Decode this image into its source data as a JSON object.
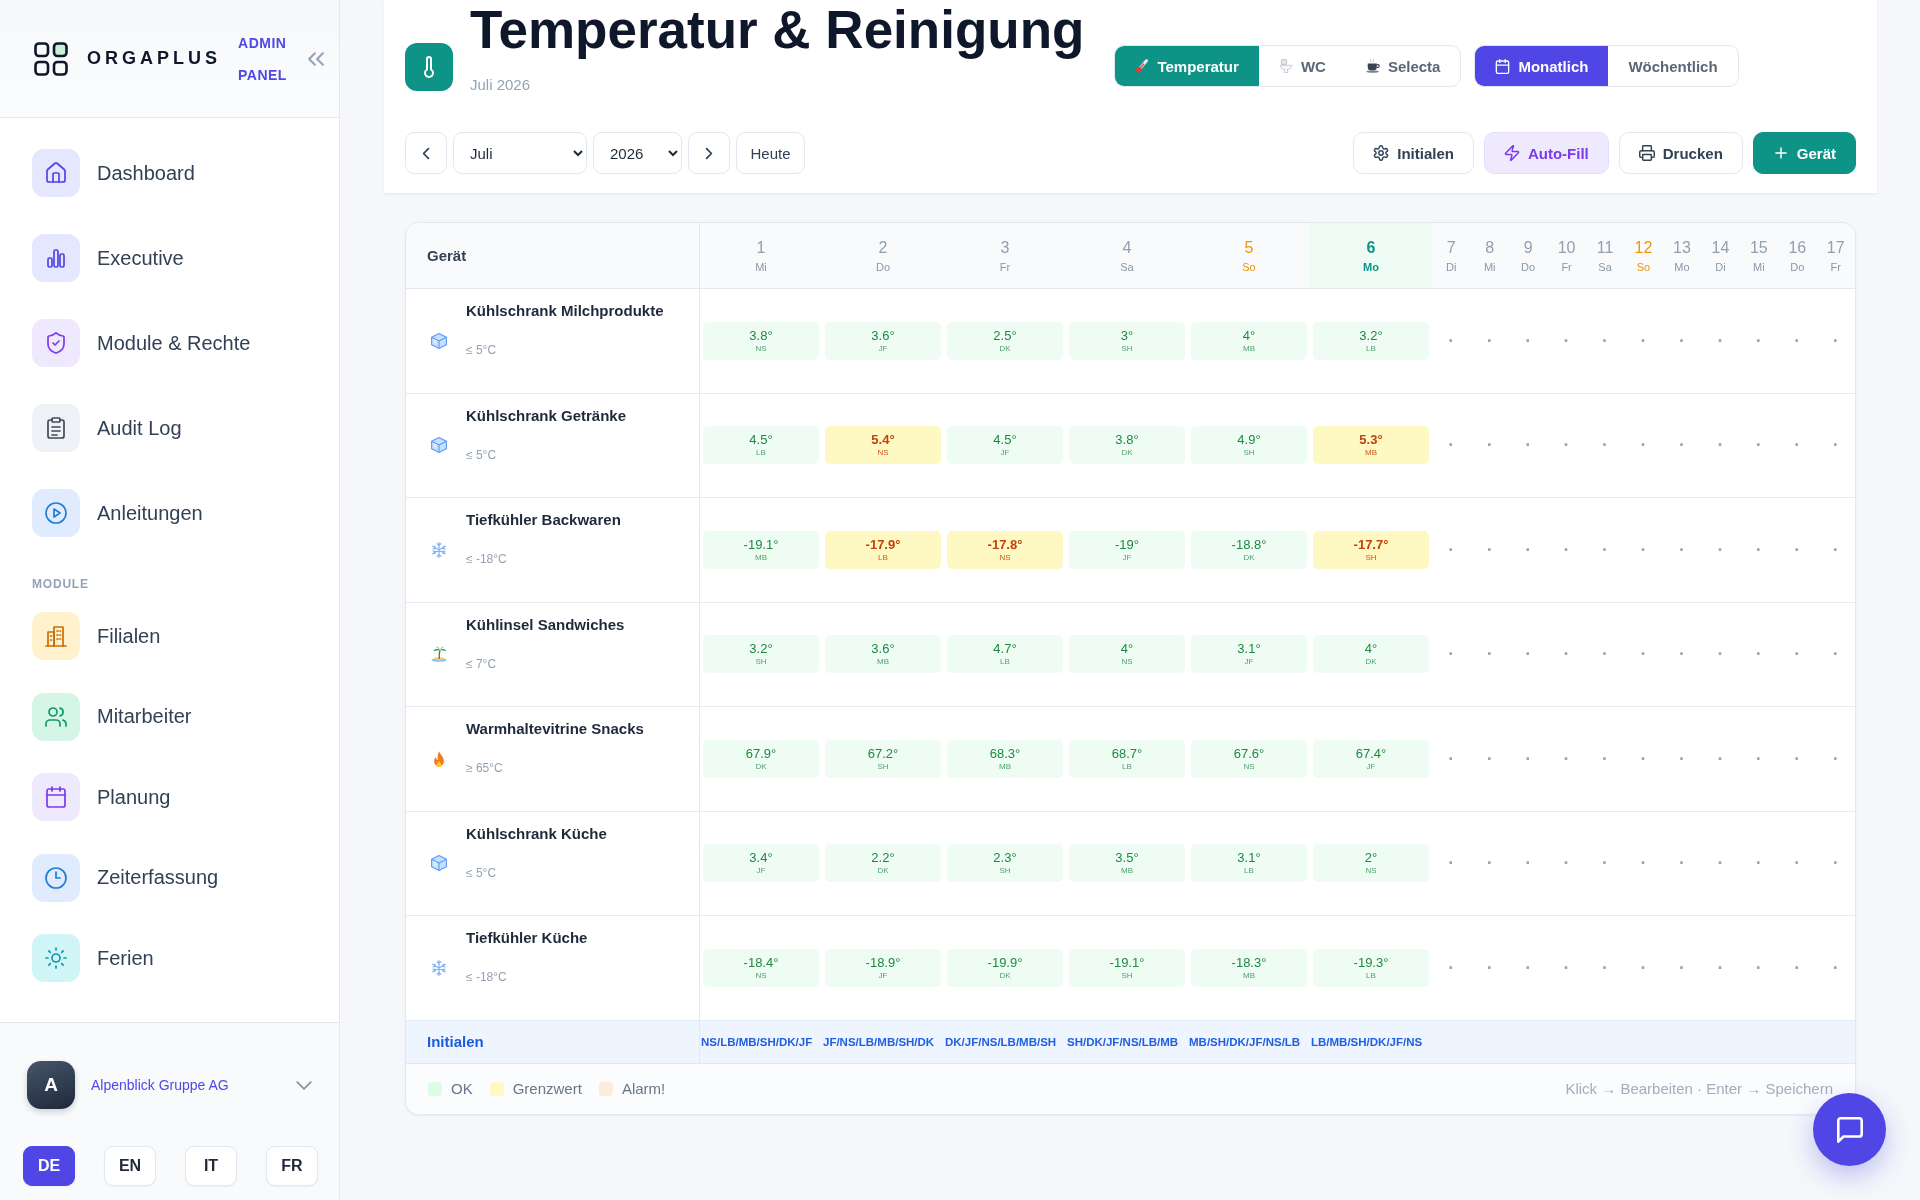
{
  "sidebar": {
    "brand": {
      "name": "ORGAPLUS",
      "tagline": "ADMIN PANEL"
    },
    "nav": [
      {
        "label": "Dashboard",
        "selected": false
      },
      {
        "label": "Executive",
        "selected": false
      },
      {
        "label": "Module & Rechte",
        "selected": false
      },
      {
        "label": "Audit Log",
        "selected": false
      },
      {
        "label": "Anleitungen",
        "selected": false
      }
    ],
    "sections": [
      {
        "title": "MODULE",
        "items": [
          {
            "label": "Filialen",
            "selected": false
          },
          {
            "label": "Mitarbeiter",
            "selected": false
          },
          {
            "label": "Planung",
            "selected": false
          },
          {
            "label": "Zeiterfassung",
            "selected": false
          },
          {
            "label": "Ferien",
            "selected": false
          }
        ]
      }
    ],
    "account": {
      "initial": "A",
      "name": "Alpenblick Gruppe AG"
    },
    "languages": [
      {
        "label": "DE",
        "selected": true
      },
      {
        "label": "EN",
        "selected": false
      },
      {
        "label": "IT",
        "selected": false
      },
      {
        "label": "FR",
        "selected": false
      }
    ]
  },
  "header": {
    "title": "Temperatur & Reinigung",
    "subtitle": "Juli 2026",
    "tabs": [
      {
        "label": "Temperatur",
        "selected": true
      },
      {
        "label": "WC",
        "selected": false
      },
      {
        "label": "Selecta",
        "selected": false
      }
    ],
    "views": [
      {
        "label": "Monatlich",
        "selected": true
      },
      {
        "label": "Wöchentlich",
        "selected": false
      }
    ],
    "month": "Juli",
    "year": "2026",
    "today_button": "Heute",
    "actions": [
      {
        "label": "Initialen",
        "kind": "plain"
      },
      {
        "label": "Auto-Fill",
        "kind": "soft"
      },
      {
        "label": "Drucken",
        "kind": "plain"
      },
      {
        "label": "Gerät",
        "kind": "primary"
      }
    ]
  },
  "table": {
    "device_heading": "Gerät",
    "days": [
      {
        "number": "1",
        "weekday": "Mi",
        "today": false,
        "sunday": false
      },
      {
        "number": "2",
        "weekday": "Do",
        "today": false,
        "sunday": false
      },
      {
        "number": "3",
        "weekday": "Fr",
        "today": false,
        "sunday": false
      },
      {
        "number": "4",
        "weekday": "Sa",
        "today": false,
        "sunday": false
      },
      {
        "number": "5",
        "weekday": "So",
        "today": false,
        "sunday": true
      },
      {
        "number": "6",
        "weekday": "Mo",
        "today": true,
        "sunday": false
      },
      {
        "number": "7",
        "weekday": "Di",
        "today": false,
        "sunday": false
      },
      {
        "number": "8",
        "weekday": "Mi",
        "today": false,
        "sunday": false
      },
      {
        "number": "9",
        "weekday": "Do",
        "today": false,
        "sunday": false
      },
      {
        "number": "10",
        "weekday": "Fr",
        "today": false,
        "sunday": false
      },
      {
        "number": "11",
        "weekday": "Sa",
        "today": false,
        "sunday": false
      },
      {
        "number": "12",
        "weekday": "So",
        "today": false,
        "sunday": true
      },
      {
        "number": "13",
        "weekday": "Mo",
        "today": false,
        "sunday": false
      },
      {
        "number": "14",
        "weekday": "Di",
        "today": false,
        "sunday": false
      },
      {
        "number": "15",
        "weekday": "Mi",
        "today": false,
        "sunday": false
      },
      {
        "number": "16",
        "weekday": "Do",
        "today": false,
        "sunday": false
      },
      {
        "number": "17",
        "weekday": "Fr",
        "today": false,
        "sunday": false
      }
    ],
    "rows": [
      {
        "kind": "fridge",
        "name": "Kühlschrank Milchprodukte",
        "limit": "≤ 5°C",
        "readings": [
          {
            "kind": "reading",
            "value": "3.8°",
            "initials": "NS",
            "warning": false
          },
          {
            "kind": "reading",
            "value": "3.6°",
            "initials": "JF",
            "warning": false
          },
          {
            "kind": "reading",
            "value": "2.5°",
            "initials": "DK",
            "warning": false
          },
          {
            "kind": "reading",
            "value": "3°",
            "initials": "SH",
            "warning": false
          },
          {
            "kind": "reading",
            "value": "4°",
            "initials": "MB",
            "warning": false
          },
          {
            "kind": "reading",
            "value": "3.2°",
            "initials": "LB",
            "warning": false
          },
          {
            "kind": "empty",
            "mark": "·"
          },
          {
            "kind": "empty",
            "mark": "·"
          },
          {
            "kind": "empty",
            "mark": "·"
          },
          {
            "kind": "empty",
            "mark": "·"
          },
          {
            "kind": "empty",
            "mark": "·"
          },
          {
            "kind": "empty",
            "mark": "·"
          },
          {
            "kind": "empty",
            "mark": "·"
          },
          {
            "kind": "empty",
            "mark": "·"
          },
          {
            "kind": "empty",
            "mark": "·"
          },
          {
            "kind": "empty",
            "mark": "·"
          },
          {
            "kind": "empty",
            "mark": "·"
          }
        ]
      },
      {
        "kind": "fridge",
        "name": "Kühlschrank Getränke",
        "limit": "≤ 5°C",
        "readings": [
          {
            "kind": "reading",
            "value": "4.5°",
            "initials": "LB",
            "warning": false
          },
          {
            "kind": "reading",
            "value": "5.4°",
            "initials": "NS",
            "warning": true
          },
          {
            "kind": "reading",
            "value": "4.5°",
            "initials": "JF",
            "warning": false
          },
          {
            "kind": "reading",
            "value": "3.8°",
            "initials": "DK",
            "warning": false
          },
          {
            "kind": "reading",
            "value": "4.9°",
            "initials": "SH",
            "warning": false
          },
          {
            "kind": "reading",
            "value": "5.3°",
            "initials": "MB",
            "warning": true
          },
          {
            "kind": "empty",
            "mark": "·"
          },
          {
            "kind": "empty",
            "mark": "·"
          },
          {
            "kind": "empty",
            "mark": "·"
          },
          {
            "kind": "empty",
            "mark": "·"
          },
          {
            "kind": "empty",
            "mark": "·"
          },
          {
            "kind": "empty",
            "mark": "·"
          },
          {
            "kind": "empty",
            "mark": "·"
          },
          {
            "kind": "empty",
            "mark": "·"
          },
          {
            "kind": "empty",
            "mark": "·"
          },
          {
            "kind": "empty",
            "mark": "·"
          },
          {
            "kind": "empty",
            "mark": "·"
          }
        ]
      },
      {
        "kind": "freezer",
        "name": "Tiefkühler Backwaren",
        "limit": "≤ -18°C",
        "readings": [
          {
            "kind": "reading",
            "value": "-19.1°",
            "initials": "MB",
            "warning": false
          },
          {
            "kind": "reading",
            "value": "-17.9°",
            "initials": "LB",
            "warning": true
          },
          {
            "kind": "reading",
            "value": "-17.8°",
            "initials": "NS",
            "warning": true
          },
          {
            "kind": "reading",
            "value": "-19°",
            "initials": "JF",
            "warning": false
          },
          {
            "kind": "reading",
            "value": "-18.8°",
            "initials": "DK",
            "warning": false
          },
          {
            "kind": "reading",
            "value": "-17.7°",
            "initials": "SH",
            "warning": true
          },
          {
            "kind": "empty",
            "mark": "·"
          },
          {
            "kind": "empty",
            "mark": "·"
          },
          {
            "kind": "empty",
            "mark": "·"
          },
          {
            "kind": "empty",
            "mark": "·"
          },
          {
            "kind": "empty",
            "mark": "·"
          },
          {
            "kind": "empty",
            "mark": "·"
          },
          {
            "kind": "empty",
            "mark": "·"
          },
          {
            "kind": "empty",
            "mark": "·"
          },
          {
            "kind": "empty",
            "mark": "·"
          },
          {
            "kind": "empty",
            "mark": "·"
          },
          {
            "kind": "empty",
            "mark": "·"
          }
        ]
      },
      {
        "kind": "cooler",
        "name": "Kühlinsel Sandwiches",
        "limit": "≤ 7°C",
        "readings": [
          {
            "kind": "reading",
            "value": "3.2°",
            "initials": "SH",
            "warning": false
          },
          {
            "kind": "reading",
            "value": "3.6°",
            "initials": "MB",
            "warning": false
          },
          {
            "kind": "reading",
            "value": "4.7°",
            "initials": "LB",
            "warning": false
          },
          {
            "kind": "reading",
            "value": "4°",
            "initials": "NS",
            "warning": false
          },
          {
            "kind": "reading",
            "value": "3.1°",
            "initials": "JF",
            "warning": false
          },
          {
            "kind": "reading",
            "value": "4°",
            "initials": "DK",
            "warning": false
          },
          {
            "kind": "empty",
            "mark": "·"
          },
          {
            "kind": "empty",
            "mark": "·"
          },
          {
            "kind": "empty",
            "mark": "·"
          },
          {
            "kind": "empty",
            "mark": "·"
          },
          {
            "kind": "empty",
            "mark": "·"
          },
          {
            "kind": "empty",
            "mark": "·"
          },
          {
            "kind": "empty",
            "mark": "·"
          },
          {
            "kind": "empty",
            "mark": "·"
          },
          {
            "kind": "empty",
            "mark": "·"
          },
          {
            "kind": "empty",
            "mark": "·"
          },
          {
            "kind": "empty",
            "mark": "·"
          }
        ]
      },
      {
        "kind": "warmer",
        "name": "Warmhaltevitrine Snacks",
        "limit": "≥ 65°C",
        "readings": [
          {
            "kind": "reading",
            "value": "67.9°",
            "initials": "DK",
            "warning": false
          },
          {
            "kind": "reading",
            "value": "67.2°",
            "initials": "SH",
            "warning": false
          },
          {
            "kind": "reading",
            "value": "68.3°",
            "initials": "MB",
            "warning": false
          },
          {
            "kind": "reading",
            "value": "68.7°",
            "initials": "LB",
            "warning": false
          },
          {
            "kind": "reading",
            "value": "67.6°",
            "initials": "NS",
            "warning": false
          },
          {
            "kind": "reading",
            "value": "67.4°",
            "initials": "JF",
            "warning": false
          },
          {
            "kind": "empty",
            "mark": "·"
          },
          {
            "kind": "empty",
            "mark": "·"
          },
          {
            "kind": "empty",
            "mark": "·"
          },
          {
            "kind": "empty",
            "mark": "·"
          },
          {
            "kind": "empty",
            "mark": "·"
          },
          {
            "kind": "empty",
            "mark": "·"
          },
          {
            "kind": "empty",
            "mark": "·"
          },
          {
            "kind": "empty",
            "mark": "·"
          },
          {
            "kind": "empty",
            "mark": "·"
          },
          {
            "kind": "empty",
            "mark": "·"
          },
          {
            "kind": "empty",
            "mark": "·"
          }
        ]
      },
      {
        "kind": "fridge",
        "name": "Kühlschrank Küche",
        "limit": "≤ 5°C",
        "readings": [
          {
            "kind": "reading",
            "value": "3.4°",
            "initials": "JF",
            "warning": false
          },
          {
            "kind": "reading",
            "value": "2.2°",
            "initials": "DK",
            "warning": false
          },
          {
            "kind": "reading",
            "value": "2.3°",
            "initials": "SH",
            "warning": false
          },
          {
            "kind": "reading",
            "value": "3.5°",
            "initials": "MB",
            "warning": false
          },
          {
            "kind": "reading",
            "value": "3.1°",
            "initials": "LB",
            "warning": false
          },
          {
            "kind": "reading",
            "value": "2°",
            "initials": "NS",
            "warning": false
          },
          {
            "kind": "empty",
            "mark": "·"
          },
          {
            "kind": "empty",
            "mark": "·"
          },
          {
            "kind": "empty",
            "mark": "·"
          },
          {
            "kind": "empty",
            "mark": "·"
          },
          {
            "kind": "empty",
            "mark": "·"
          },
          {
            "kind": "empty",
            "mark": "·"
          },
          {
            "kind": "empty",
            "mark": "·"
          },
          {
            "kind": "empty",
            "mark": "·"
          },
          {
            "kind": "empty",
            "mark": "·"
          },
          {
            "kind": "empty",
            "mark": "·"
          },
          {
            "kind": "empty",
            "mark": "·"
          }
        ]
      },
      {
        "kind": "freezer",
        "name": "Tiefkühler Küche",
        "limit": "≤ -18°C",
        "readings": [
          {
            "kind": "reading",
            "value": "-18.4°",
            "initials": "NS",
            "warning": false
          },
          {
            "kind": "reading",
            "value": "-18.9°",
            "initials": "JF",
            "warning": false
          },
          {
            "kind": "reading",
            "value": "-19.9°",
            "initials": "DK",
            "warning": false
          },
          {
            "kind": "reading",
            "value": "-19.1°",
            "initials": "SH",
            "warning": false
          },
          {
            "kind": "reading",
            "value": "-18.3°",
            "initials": "MB",
            "warning": false
          },
          {
            "kind": "reading",
            "value": "-19.3°",
            "initials": "LB",
            "warning": false
          },
          {
            "kind": "empty",
            "mark": "·"
          },
          {
            "kind": "empty",
            "mark": "·"
          },
          {
            "kind": "empty",
            "mark": "·"
          },
          {
            "kind": "empty",
            "mark": "·"
          },
          {
            "kind": "empty",
            "mark": "·"
          },
          {
            "kind": "empty",
            "mark": "·"
          },
          {
            "kind": "empty",
            "mark": "·"
          },
          {
            "kind": "empty",
            "mark": "·"
          },
          {
            "kind": "empty",
            "mark": "·"
          },
          {
            "kind": "empty",
            "mark": "·"
          },
          {
            "kind": "empty",
            "mark": "·"
          }
        ]
      }
    ],
    "initials_row": {
      "label": "Initialen",
      "values": [
        "NS/LB/MB/SH/DK/JF",
        "JF/NS/LB/MB/SH/DK",
        "DK/JF/NS/LB/MB/SH",
        "SH/DK/JF/NS/LB/MB",
        "MB/SH/DK/JF/NS/LB",
        "LB/MB/SH/DK/JF/NS"
      ]
    }
  },
  "legend": {
    "items": [
      {
        "label": "OK",
        "color": "#dcfce7"
      },
      {
        "label": "Grenzwert",
        "color": "#fef9c3"
      },
      {
        "label": "Alarm!",
        "color": "#fdecd9"
      }
    ],
    "hint": "Klick → Bearbeiten · Enter → Speichern"
  }
}
